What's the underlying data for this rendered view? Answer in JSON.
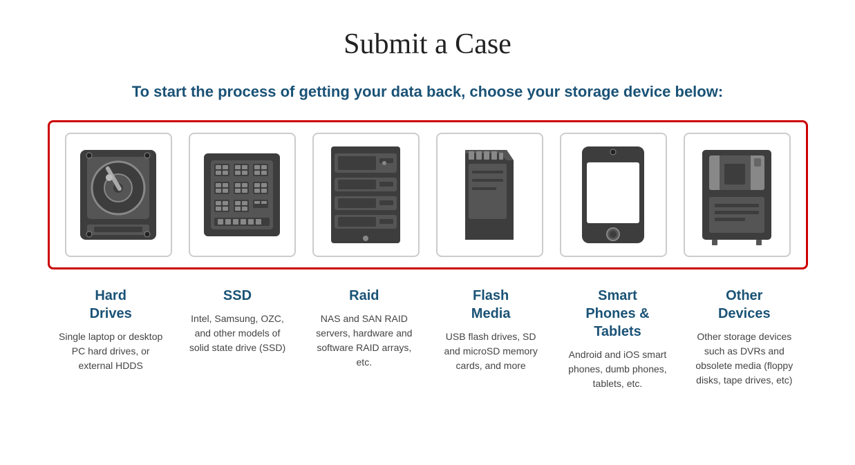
{
  "page": {
    "title": "Submit a Case",
    "subtitle": "To start the process of getting your data back, choose your storage device below:"
  },
  "devices": [
    {
      "id": "hard-drives",
      "label": "Hard Drives",
      "description": "Single laptop or desktop PC hard drives, or external HDDS"
    },
    {
      "id": "ssd",
      "label": "SSD",
      "description": "Intel, Samsung, OZC, and other models of solid state drive (SSD)"
    },
    {
      "id": "raid",
      "label": "Raid",
      "description": "NAS and SAN RAID servers, hardware and software RAID arrays, etc."
    },
    {
      "id": "flash-media",
      "label": "Flash Media",
      "description": "USB flash drives, SD and microSD memory cards, and more"
    },
    {
      "id": "smart-phones",
      "label": "Smart Phones & Tablets",
      "description": "Android and iOS smart phones, dumb phones, tablets, etc."
    },
    {
      "id": "other-devices",
      "label": "Other Devices",
      "description": "Other storage devices such as DVRs and obsolete media (floppy disks, tape drives, etc)"
    }
  ]
}
